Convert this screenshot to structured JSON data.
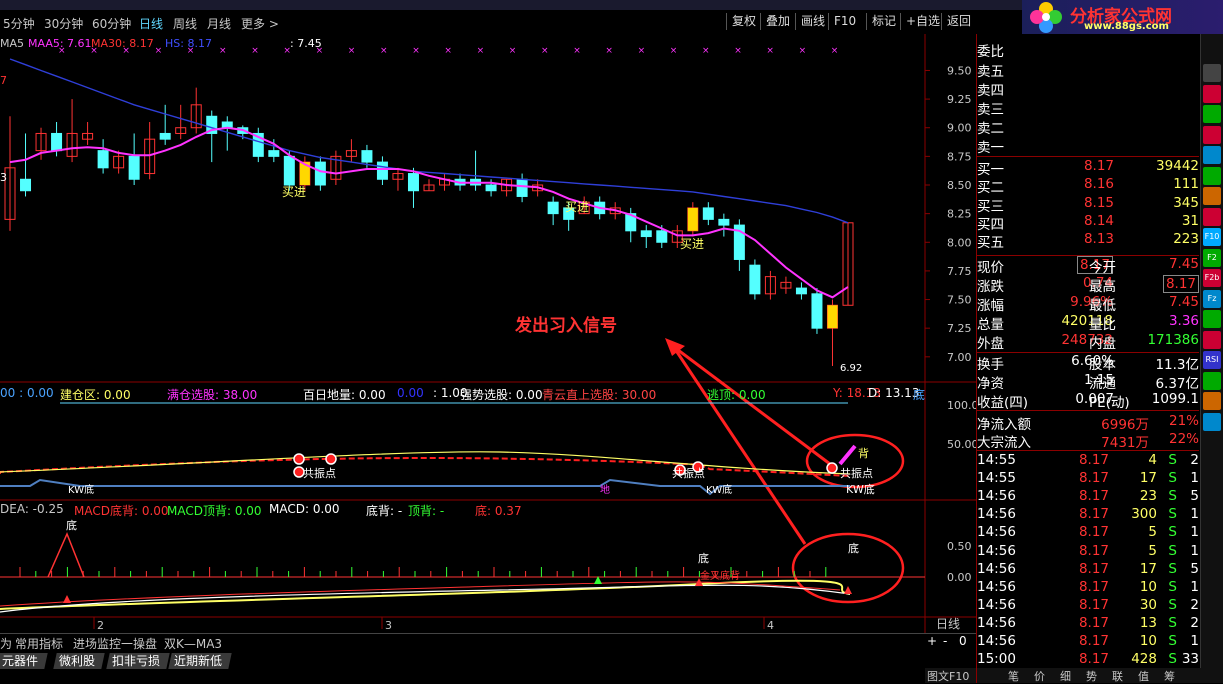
{
  "periods": [
    {
      "label": "5分钟",
      "active": false
    },
    {
      "label": "30分钟",
      "active": false
    },
    {
      "label": "60分钟",
      "active": false
    },
    {
      "label": "日线",
      "active": true
    },
    {
      "label": "周线",
      "active": false
    },
    {
      "label": "月线",
      "active": false
    },
    {
      "label": "更多 >",
      "active": false
    }
  ],
  "toolbar": [
    "复权",
    "叠加",
    "画线",
    "F10",
    "标记",
    "+自选",
    "返回"
  ],
  "logo": {
    "title": "分析家公式网",
    "url": "www.88gs.com"
  },
  "main_legend": {
    "ma5": "MA5",
    "maa5": "MAA5: 7.61",
    "maa30": "MA30: 8.17",
    "hs": "HS: 8.17",
    "v": ": 7.45"
  },
  "price_axis": [
    "9.50",
    "9.25",
    "9.00",
    "8.75",
    "8.50",
    "8.25",
    "8.00",
    "7.75",
    "7.50",
    "7.25",
    "7.00"
  ],
  "left_edge_marks": [
    "7",
    "3"
  ],
  "signals": {
    "buy": "买进",
    "low_price": "6.92"
  },
  "annotation": "发出习入信号",
  "mid_legend": [
    {
      "text": "00 : 0.00",
      "color": "#4aa3ff"
    },
    {
      "text": "建仓区: 0.00",
      "color": "#ffff66"
    },
    {
      "text": "满仓选股: 38.00",
      "color": "#ff33ff"
    },
    {
      "text": "百日地量: 0.00",
      "color": "#ffffff"
    },
    {
      "text": "0.00",
      "color": "#3333ff"
    },
    {
      "text": ": 1.00",
      "color": "#ffffff"
    },
    {
      "text": "强势选股: 0.00",
      "color": "#ffffff"
    },
    {
      "text": "青云直上选股: 30.00",
      "color": "#ff4444"
    },
    {
      "text": "逃顶: 0.00",
      "color": "#33ff33"
    },
    {
      "text": "Y: 18.13",
      "color": "#ff3333"
    },
    {
      "text": "D: 13.13",
      "color": "#ffffff"
    },
    {
      "text": "底",
      "color": "#4aa3ff"
    }
  ],
  "mid_axis": [
    "100.0",
    "50.00"
  ],
  "mid_labels": {
    "resonance": "共振点",
    "top": "背",
    "kw": "KW底",
    "ground": "地"
  },
  "macd_legend": [
    {
      "text": "DEA: -0.25",
      "color": "#c8c8c8"
    },
    {
      "text": "MACD底背: 0.00",
      "color": "#ff3333"
    },
    {
      "text": "MACD顶背: 0.00",
      "color": "#33ff33"
    },
    {
      "text": "MACD: 0.00",
      "color": "#ffffff"
    },
    {
      "text": "底背: -",
      "color": "#ffffff"
    },
    {
      "text": "顶背: -",
      "color": "#33ff33"
    },
    {
      "text": "底: 0.37",
      "color": "#ff3333"
    }
  ],
  "macd_axis": [
    "0.50",
    "0.00"
  ],
  "macd_labels": {
    "bottom": "底",
    "mixed": "金叉底背"
  },
  "x_axis": [
    "2",
    "3",
    "4"
  ],
  "period_badge": "日线",
  "zoom": [
    "+",
    "-",
    "0"
  ],
  "tabs1": [
    "为",
    "常用指标",
    "进场监控一操盘",
    "双K—MA3"
  ],
  "tabs2": [
    "元器件",
    "微利股",
    "扣非亏损",
    "近期新低"
  ],
  "order_book": {
    "wei_bi": "委比",
    "sells": [
      {
        "label": "卖五"
      },
      {
        "label": "卖四"
      },
      {
        "label": "卖三"
      },
      {
        "label": "卖二"
      },
      {
        "label": "卖一"
      }
    ],
    "buys": [
      {
        "label": "买一",
        "price": "8.17",
        "vol": "39442"
      },
      {
        "label": "买二",
        "price": "8.16",
        "vol": "111"
      },
      {
        "label": "买三",
        "price": "8.15",
        "vol": "345"
      },
      {
        "label": "买四",
        "price": "8.14",
        "vol": "31"
      },
      {
        "label": "买五",
        "price": "8.13",
        "vol": "223"
      }
    ]
  },
  "quote": [
    {
      "l1": "现价",
      "v1": "8.17",
      "l2": "今开",
      "v2": "7.45",
      "c1": "#ff3333",
      "c2": "#ff3333",
      "box1": true,
      "box2": false
    },
    {
      "l1": "涨跌",
      "v1": "0.74",
      "l2": "最高",
      "v2": "8.17",
      "c1": "#ff3333",
      "c2": "#ff3333",
      "box1": false,
      "box2": true
    },
    {
      "l1": "涨幅",
      "v1": "9.96%",
      "l2": "最低",
      "v2": "7.45",
      "c1": "#ff3333",
      "c2": "#ff3333",
      "box1": false,
      "box2": false
    },
    {
      "l1": "总量",
      "v1": "420118",
      "l2": "量比",
      "v2": "3.36",
      "c1": "#ffff66",
      "c2": "#ff33ff",
      "box1": false,
      "box2": false
    },
    {
      "l1": "外盘",
      "v1": "248732",
      "l2": "内盘",
      "v2": "171386",
      "c1": "#ff3333",
      "c2": "#33ff33",
      "box1": false,
      "box2": false
    }
  ],
  "quote2": [
    {
      "l1": "换手",
      "v1": "6.60%",
      "l2": "股本",
      "v2": "11.3亿"
    },
    {
      "l1": "净资",
      "v1": "1.15",
      "l2": "流通",
      "v2": "6.37亿"
    },
    {
      "l1": "收益(四)",
      "v1": "0.007",
      "l2": "PE(动)",
      "v2": "1099.1"
    }
  ],
  "flows": [
    {
      "label": "净流入额",
      "value": "6996万",
      "pct": "21%"
    },
    {
      "label": "大宗流入",
      "value": "7431万",
      "pct": "22%"
    }
  ],
  "ticks": [
    {
      "t": "14:55",
      "p": "8.17",
      "v": "4",
      "s": "S",
      "n": "2"
    },
    {
      "t": "14:55",
      "p": "8.17",
      "v": "17",
      "s": "S",
      "n": "1"
    },
    {
      "t": "14:56",
      "p": "8.17",
      "v": "23",
      "s": "S",
      "n": "5"
    },
    {
      "t": "14:56",
      "p": "8.17",
      "v": "300",
      "s": "S",
      "n": "1"
    },
    {
      "t": "14:56",
      "p": "8.17",
      "v": "5",
      "s": "S",
      "n": "1"
    },
    {
      "t": "14:56",
      "p": "8.17",
      "v": "5",
      "s": "S",
      "n": "1"
    },
    {
      "t": "14:56",
      "p": "8.17",
      "v": "17",
      "s": "S",
      "n": "5"
    },
    {
      "t": "14:56",
      "p": "8.17",
      "v": "10",
      "s": "S",
      "n": "1"
    },
    {
      "t": "14:56",
      "p": "8.17",
      "v": "30",
      "s": "S",
      "n": "2"
    },
    {
      "t": "14:56",
      "p": "8.17",
      "v": "13",
      "s": "S",
      "n": "2"
    },
    {
      "t": "14:56",
      "p": "8.17",
      "v": "10",
      "s": "S",
      "n": "1"
    },
    {
      "t": "15:00",
      "p": "8.17",
      "v": "428",
      "s": "S",
      "n": "33"
    }
  ],
  "bottom_right": [
    "图文F10",
    "笔",
    "价",
    "细",
    "势",
    "联",
    "值",
    "筹"
  ],
  "side_icons": [
    "",
    "",
    "",
    "",
    "",
    "",
    "",
    "",
    "F10",
    "F2",
    "F2b",
    "Fz",
    "",
    "",
    "RSI",
    "",
    "",
    ""
  ],
  "colors": {
    "up": "#ff3333",
    "down": "#54ffff",
    "ma": "#ff33ff",
    "ma30": "#2f3fd8",
    "grid": "#8b0000"
  },
  "chart_data": {
    "type": "candlestick",
    "ylim": [
      6.85,
      9.6
    ],
    "candles": [
      [
        8.2,
        8.65,
        9.1,
        8.1
      ],
      [
        8.55,
        8.45,
        8.95,
        8.4
      ],
      [
        8.8,
        8.95,
        9.0,
        8.72
      ],
      [
        8.95,
        8.8,
        9.05,
        8.75
      ],
      [
        8.75,
        8.95,
        9.25,
        8.7
      ],
      [
        8.9,
        8.95,
        9.05,
        8.85
      ],
      [
        8.8,
        8.65,
        8.9,
        8.6
      ],
      [
        8.65,
        8.75,
        8.8,
        8.6
      ],
      [
        8.75,
        8.55,
        8.95,
        8.5
      ],
      [
        8.6,
        8.9,
        9.05,
        8.55
      ],
      [
        8.95,
        8.9,
        9.2,
        8.85
      ],
      [
        8.95,
        9.0,
        9.2,
        8.9
      ],
      [
        9.0,
        9.2,
        9.35,
        8.95
      ],
      [
        9.1,
        8.95,
        9.15,
        8.7
      ],
      [
        9.05,
        9.0,
        9.1,
        8.8
      ],
      [
        9.0,
        8.95,
        9.02,
        8.9
      ],
      [
        8.95,
        8.75,
        9.0,
        8.7
      ],
      [
        8.8,
        8.75,
        8.9,
        8.7
      ],
      [
        8.75,
        8.5,
        8.8,
        8.45
      ],
      [
        8.5,
        8.7,
        8.75,
        8.45
      ],
      [
        8.7,
        8.5,
        8.75,
        8.45
      ],
      [
        8.55,
        8.75,
        8.8,
        8.5
      ],
      [
        8.75,
        8.8,
        8.9,
        8.7
      ],
      [
        8.8,
        8.7,
        8.85,
        8.65
      ],
      [
        8.7,
        8.55,
        8.75,
        8.5
      ],
      [
        8.55,
        8.6,
        8.65,
        8.45
      ],
      [
        8.6,
        8.45,
        8.65,
        8.3
      ],
      [
        8.45,
        8.5,
        8.55,
        8.45
      ],
      [
        8.5,
        8.55,
        8.6,
        8.45
      ],
      [
        8.55,
        8.5,
        8.6,
        8.45
      ],
      [
        8.55,
        8.5,
        8.8,
        8.45
      ],
      [
        8.5,
        8.45,
        8.55,
        8.4
      ],
      [
        8.45,
        8.55,
        8.55,
        8.4
      ],
      [
        8.55,
        8.4,
        8.6,
        8.35
      ],
      [
        8.45,
        8.5,
        8.55,
        8.4
      ],
      [
        8.35,
        8.25,
        8.4,
        8.15
      ],
      [
        8.3,
        8.2,
        8.35,
        8.1
      ],
      [
        8.25,
        8.35,
        8.4,
        8.25
      ],
      [
        8.35,
        8.25,
        8.4,
        8.2
      ],
      [
        8.25,
        8.3,
        8.35,
        8.2
      ],
      [
        8.25,
        8.1,
        8.3,
        8.0
      ],
      [
        8.1,
        8.05,
        8.15,
        7.95
      ],
      [
        8.1,
        8.0,
        8.15,
        7.95
      ],
      [
        8.0,
        8.1,
        8.15,
        7.95
      ],
      [
        8.1,
        8.3,
        8.35,
        8.05
      ],
      [
        8.3,
        8.2,
        8.35,
        8.15
      ],
      [
        8.2,
        8.15,
        8.25,
        8.05
      ],
      [
        8.15,
        7.85,
        8.2,
        7.75
      ],
      [
        7.8,
        7.55,
        7.85,
        7.5
      ],
      [
        7.55,
        7.7,
        7.75,
        7.5
      ],
      [
        7.6,
        7.65,
        7.7,
        7.55
      ],
      [
        7.6,
        7.55,
        7.65,
        7.5
      ],
      [
        7.55,
        7.25,
        7.6,
        7.2
      ],
      [
        7.25,
        7.45,
        7.5,
        6.92
      ],
      [
        7.45,
        8.17,
        8.17,
        7.45
      ]
    ],
    "ma5": [
      8.7,
      8.72,
      8.78,
      8.8,
      8.82,
      8.83,
      8.82,
      8.78,
      8.76,
      8.76,
      8.8,
      8.85,
      8.92,
      8.98,
      9.0,
      8.98,
      8.92,
      8.86,
      8.76,
      8.68,
      8.62,
      8.6,
      8.62,
      8.64,
      8.64,
      8.64,
      8.62,
      8.58,
      8.55,
      8.52,
      8.52,
      8.52,
      8.5,
      8.49,
      8.48,
      8.44,
      8.38,
      8.34,
      8.3,
      8.28,
      8.24,
      8.18,
      8.12,
      8.06,
      8.06,
      8.08,
      8.12,
      8.1,
      8.02,
      7.9,
      7.78,
      7.68,
      7.58,
      7.52,
      7.61
    ],
    "ma30": [
      9.6,
      9.55,
      9.5,
      9.45,
      9.4,
      9.35,
      9.3,
      9.25,
      9.2,
      9.16,
      9.12,
      9.08,
      9.04,
      9.0,
      8.96,
      8.92,
      8.88,
      8.84,
      8.8,
      8.77,
      8.74,
      8.72,
      8.7,
      8.68,
      8.66,
      8.64,
      8.62,
      8.61,
      8.6,
      8.59,
      8.58,
      8.57,
      8.56,
      8.55,
      8.54,
      8.53,
      8.52,
      8.51,
      8.5,
      8.49,
      8.48,
      8.47,
      8.46,
      8.45,
      8.44,
      8.42,
      8.4,
      8.38,
      8.36,
      8.34,
      8.32,
      8.29,
      8.26,
      8.22,
      8.17
    ]
  }
}
